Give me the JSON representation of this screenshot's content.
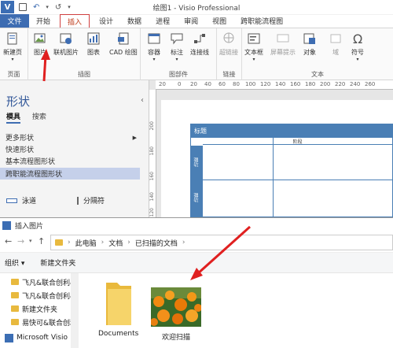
{
  "titlebar": {
    "logo_letter": "V",
    "undo": "↶",
    "redo": "↺",
    "more": "▾",
    "title": "绘图1 - Visio Professional"
  },
  "tabs": [
    "文件",
    "开始",
    "插入",
    "设计",
    "数据",
    "进程",
    "审阅",
    "视图",
    "跨职能流程图"
  ],
  "active_tab": "插入",
  "ribbon": {
    "groups": {
      "page": "页面",
      "illustration": "插图",
      "diagram_parts": "图部件",
      "links": "链接",
      "text": "文本"
    },
    "buttons": {
      "new_page": "新建页",
      "picture": "图片",
      "online_picture": "联机图片",
      "chart": "图表",
      "cad": "CAD 绘图",
      "container": "容器",
      "callout": "标注",
      "connector": "连接线",
      "hyperlink": "超链接",
      "textbox": "文本框",
      "screentip": "屏幕提示",
      "object": "对象",
      "field": "域",
      "symbol": "符号"
    }
  },
  "shapes_panel": {
    "title": "形状",
    "tab_stencils": "模具",
    "tab_search": "搜索",
    "items": [
      "更多形状",
      "快速形状",
      "基本流程图形状",
      "跨职能流程图形状"
    ],
    "shape_swimlane": "泳道",
    "shape_separator": "分隔符"
  },
  "drawing": {
    "ruler_marks": [
      "20",
      "0",
      "20",
      "40",
      "60",
      "80",
      "100",
      "120",
      "140",
      "160",
      "180",
      "200",
      "220",
      "240",
      "260"
    ],
    "vruler_marks": [
      "200",
      "180",
      "160",
      "140",
      "120"
    ],
    "swimlane_title": "标题",
    "phase_label": "阶段",
    "lane_label": "功能"
  },
  "dialog": {
    "title": "插入图片",
    "path": [
      "此电脑",
      "文档",
      "已扫描的文档"
    ],
    "organize": "组织 ▾",
    "new_folder": "新建文件夹",
    "nav_items": [
      "飞凡&联合创利&",
      "飞凡&联合创利&",
      "新建文件夹",
      "易快可&联合创利",
      "Microsoft Visio"
    ],
    "files": [
      "Documents",
      "欢迎扫描"
    ]
  },
  "colors": {
    "file_tab": "#3e6db2",
    "active_outline": "#d04040",
    "header_blue": "#4a7fb5",
    "arrow_red": "#e02020"
  }
}
